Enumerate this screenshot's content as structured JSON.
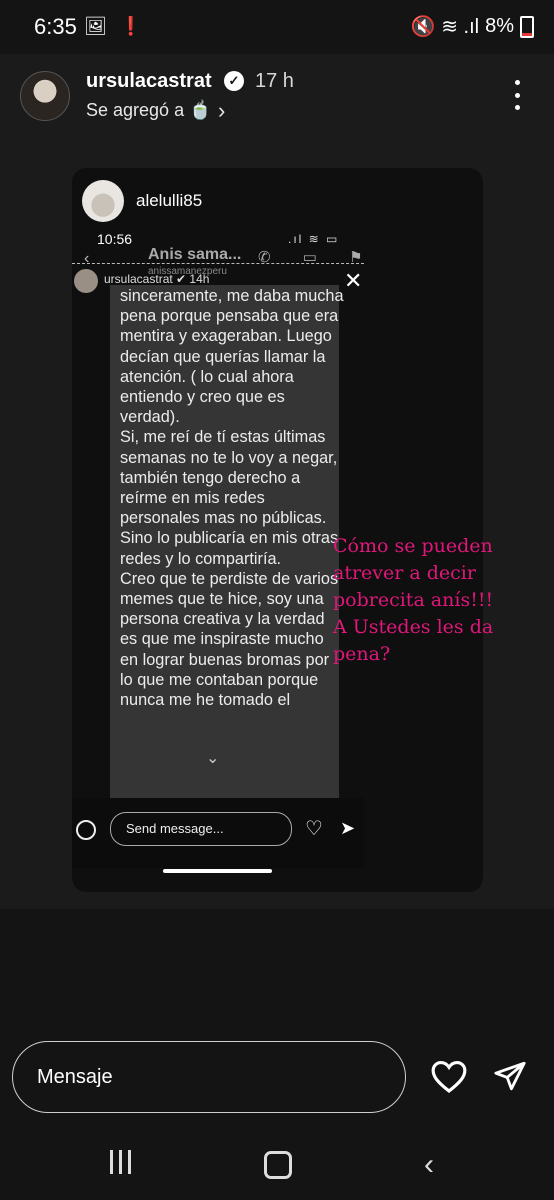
{
  "status": {
    "time": "6:35",
    "battery": "8%",
    "left_icons": "🖼 ❗",
    "right_icons": "🔇 ≋ .ıl"
  },
  "story": {
    "username": "ursulacastrat",
    "time_ago": "17 h",
    "added_label": "Se agregó a 🍵",
    "chevron": "›"
  },
  "card": {
    "username": "alelulli85",
    "inner_time": "10:56",
    "inner_status_icons": ".ıl ≋ ▭",
    "inner_back": "‹",
    "inner_header_name": "Anis sama...",
    "inner_header_handle": "anissamanezperu",
    "inner_tools": "✆ ▭ ⚑",
    "inner_overlay_user": "ursulacastrat ✔ 14h",
    "close": "✕",
    "message": "sinceramente, me daba mucha pena porque pensaba que era mentira y exageraban. Luego decían que querías llamar la atención. ( lo cual ahora entiendo y creo que es verdad).\nSi, me reí de tí estas últimas semanas no te lo voy a negar, también tengo derecho a reírme en mis redes personales mas no públicas. Sino lo publicaría en mis otras redes y lo compartiría.\nCreo que te perdiste de varios memes que te hice, soy una persona creativa y la verdad es que me inspiraste mucho en lograr buenas bromas por lo que me contaban porque nunca me he tomado el",
    "inner_chevron": "⌄",
    "input_placeholder": "Send message...",
    "heart": "♡",
    "send": "➤",
    "overlay_note": "Cómo se pueden atrever a decir pobrecita anís!!!\nA Ustedes les da pena?"
  },
  "reply": {
    "placeholder": "Mensaje"
  },
  "colors": {
    "accent_pink": "#e0177a",
    "background": "#141414"
  }
}
